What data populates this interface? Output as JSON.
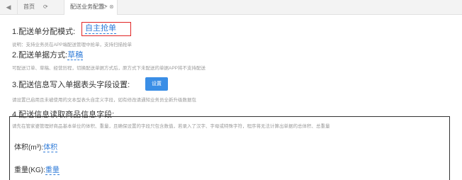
{
  "tabs": {
    "back_icon": "◀",
    "home_label": "首页",
    "active_label": "配送业务配置",
    "refresh_icon": "⟳",
    "close_icon": "⊗"
  },
  "section1": {
    "title": "1.配送单分配模式:",
    "mode_value": "自主抢单",
    "note": "说明：支持业务员在APP端配送管理中抢单，支持扫描抢单"
  },
  "section2": {
    "title": "2.配送单据方式:",
    "value": "草稿",
    "note": "可配送订单、草稿、经营历程，切换配送单据方式后，原方式下未配送的单据APP将不支持配送"
  },
  "section3": {
    "title": "3.配送信息写入单据表头字段设置:",
    "button_label": "设置",
    "note": "请设置已启用且未被使用的文本型表头自定义字段，如有修改请通知业务员全新升级数据包"
  },
  "section4": {
    "title": "4.配送信息读取商品信息字段:",
    "note": "请先在管家婆管理好商品基本单位的体积、重量，且确保设置的字段只包含数值，若录入了汉字、字母或特殊字符，程序将无法计算出单据的总体积、总重量",
    "volume_label": "体积(m³):",
    "volume_value": "体积",
    "weight_label": "重量(KG):",
    "weight_value": "重量"
  },
  "colors": {
    "link": "#2f7bd8",
    "highlight_border": "#e02424",
    "button_bg": "#3a8ee6"
  }
}
